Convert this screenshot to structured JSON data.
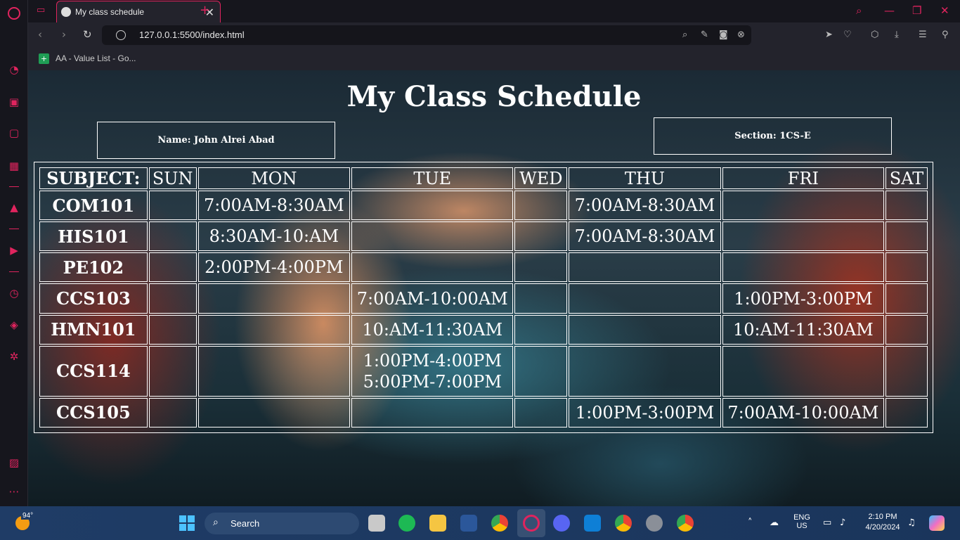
{
  "browser": {
    "tab_title": "My class schedule",
    "url": "127.0.0.1:5500/index.html",
    "bookmark_label": "AA - Value List - Go...",
    "accent_color": "#e0245e"
  },
  "page": {
    "title": "My Class Schedule",
    "name_label": "Name: John Alrei Abad",
    "section_label": "Section: 1CS-E"
  },
  "schedule": {
    "headers": [
      "SUBJECT:",
      "SUN",
      "MON",
      "TUE",
      "WED",
      "THU",
      "FRI",
      "SAT"
    ],
    "rows": [
      {
        "subject": "COM101",
        "sun": "",
        "mon": "7:00AM-8:30AM",
        "tue": "",
        "wed": "",
        "thu": "7:00AM-8:30AM",
        "fri": "",
        "sat": ""
      },
      {
        "subject": "HIS101",
        "sun": "",
        "mon": "8:30AM-10:AM",
        "tue": "",
        "wed": "",
        "thu": "7:00AM-8:30AM",
        "fri": "",
        "sat": ""
      },
      {
        "subject": "PE102",
        "sun": "",
        "mon": "2:00PM-4:00PM",
        "tue": "",
        "wed": "",
        "thu": "",
        "fri": "",
        "sat": ""
      },
      {
        "subject": "CCS103",
        "sun": "",
        "mon": "",
        "tue": "7:00AM-10:00AM",
        "wed": "",
        "thu": "",
        "fri": "1:00PM-3:00PM",
        "sat": ""
      },
      {
        "subject": "HMN101",
        "sun": "",
        "mon": "",
        "tue": "10:AM-11:30AM",
        "wed": "",
        "thu": "",
        "fri": "10:AM-11:30AM",
        "sat": ""
      },
      {
        "subject": "CCS114",
        "sun": "",
        "mon": "",
        "tue": "1:00PM-4:00PM",
        "tue2": "5:00PM-7:00PM",
        "wed": "",
        "thu": "",
        "fri": "",
        "sat": ""
      },
      {
        "subject": "CCS105",
        "sun": "",
        "mon": "",
        "tue": "",
        "wed": "",
        "thu": "1:00PM-3:00PM",
        "fri": "7:00AM-10:00AM",
        "sat": ""
      }
    ]
  },
  "taskbar": {
    "weather_temp": "94°",
    "search_placeholder": "Search",
    "lang_line1": "ENG",
    "lang_line2": "US",
    "time": "2:10 PM",
    "date": "4/20/2024"
  }
}
